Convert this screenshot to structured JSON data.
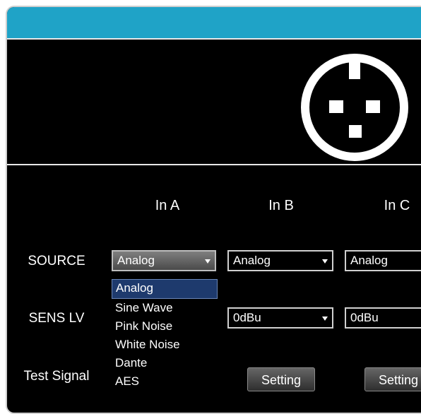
{
  "columns": [
    "In A",
    "In B",
    "In C"
  ],
  "rows": {
    "source_label": "SOURCE",
    "sens_label": "SENS LV",
    "test_label": "Test Signal"
  },
  "source": {
    "a": "Analog",
    "b": "Analog",
    "c": "Analog"
  },
  "sens": {
    "b": "0dBu",
    "c": "0dBu"
  },
  "dropdown_options": [
    "Analog",
    "Sine Wave",
    "Pink Noise",
    "White Noise",
    "Dante",
    "AES"
  ],
  "dropdown_selected": "Analog",
  "setting_label": "Setting",
  "colors": {
    "title_bar": "#1fa3c7",
    "background": "#000000",
    "selected_option": "#1e3a6d"
  },
  "icons": {
    "connector": "xlr-connector-icon",
    "dropdown_arrow": "chevron-down-icon"
  }
}
